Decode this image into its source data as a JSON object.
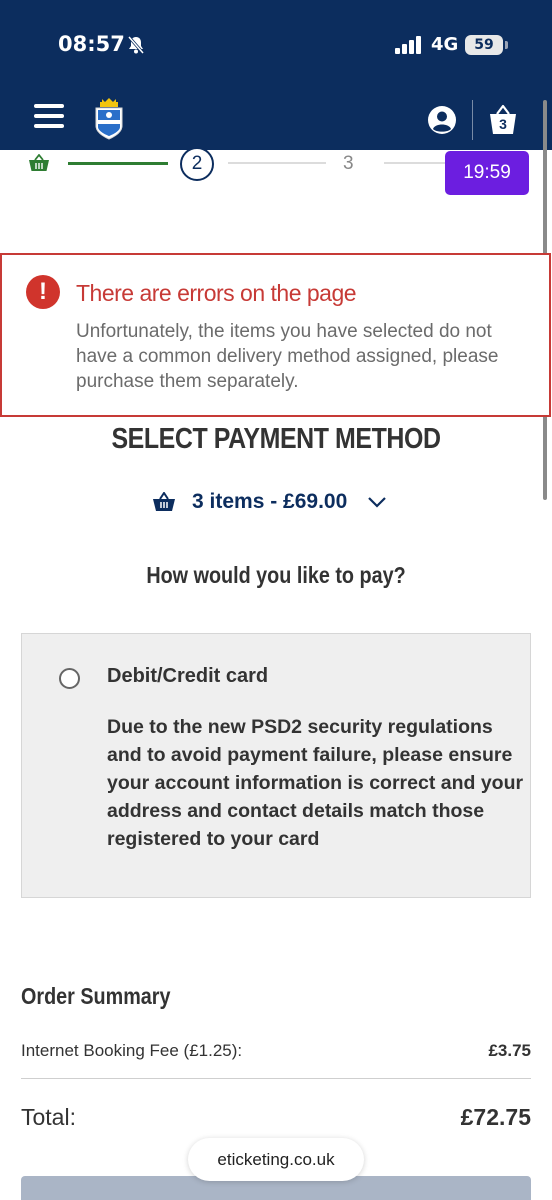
{
  "status_bar": {
    "time": "08:57",
    "network": "4G",
    "battery": "59"
  },
  "header": {
    "icons": [
      "menu-icon",
      "club-crest",
      "account-icon",
      "basket-icon"
    ],
    "basket_count": "3"
  },
  "progress": {
    "current_step": "2",
    "next_step": "3",
    "timer": "19:59",
    "colors": {
      "done": "#2e7d32",
      "current": "#0c2d5e",
      "timer": "#6c1ee0"
    }
  },
  "error": {
    "title": "There are errors on the page",
    "message": "Unfortunately, the items you have selected do not have a common delivery method assigned, please purchase them separately.",
    "color": "#c73a36"
  },
  "payment": {
    "title": "SELECT PAYMENT METHOD",
    "basket_summary": "3 items - £69.00",
    "question": "How would you like to pay?",
    "option_label": "Debit/Credit card",
    "option_note": "Due to the new PSD2 security regulations and to avoid payment failure, please ensure your account information is correct and your address and contact details match those registered to your card",
    "option_selected": false
  },
  "order_summary": {
    "title": "Order Summary",
    "fee_label": "Internet Booking Fee (£1.25):",
    "fee_value": "£3.75",
    "total_label": "Total:",
    "total_value": "£72.75"
  },
  "browser": {
    "url": "eticketing.co.uk"
  },
  "theme": {
    "primary": "#0c2d5e",
    "panel_bg": "#efefef"
  }
}
